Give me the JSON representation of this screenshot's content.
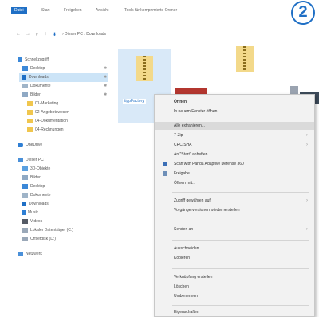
{
  "ribbon": {
    "tabs": [
      "Datei",
      "Start",
      "Freigeben",
      "Ansicht",
      "Tools für komprimierte Ordner"
    ]
  },
  "address": {
    "nav": [
      "←",
      "→",
      "∨",
      "↑"
    ],
    "path": "› Dieser PC › Downloads"
  },
  "sidebar": {
    "items": [
      "Schnellzugriff",
      "Desktop",
      "Downloads",
      "Dokumente",
      "Bilder",
      "01-Marketing",
      "02-Angebotswesen",
      "04-Dokumentation",
      "04-Rechnungen",
      "OneDrive",
      "Dieser PC",
      "3D-Objekte",
      "Bilder",
      "Desktop",
      "Dokumente",
      "Downloads",
      "Musik",
      "Videos",
      "Lokaler Datenträger (C:)",
      "Offsetdisk (D:)",
      "Netzwerk"
    ]
  },
  "file": {
    "label": "tippFactory"
  },
  "context_menu": {
    "items": [
      "Öffnen",
      "In neuem Fenster öffnen",
      "Alle extrahieren...",
      "7-Zip",
      "CRC SHA",
      "An \"Start\" anheften",
      "Scan with Panda Adaptive Defense 360",
      "Freigabe",
      "Öffnen mit...",
      "Zugriff gewähren auf",
      "Vorgängerversionen wiederherstellen",
      "Senden an",
      "Ausschneiden",
      "Kopieren",
      "Verknüpfung erstellen",
      "Löschen",
      "Umbenennen",
      "Eigenschaften"
    ]
  },
  "badge": {
    "number": "2"
  },
  "colors": {
    "accent": "#1f6fc5",
    "selection": "#cce4f7",
    "menu_bg": "#f2f2f2",
    "menu_highlight": "#dadada"
  }
}
